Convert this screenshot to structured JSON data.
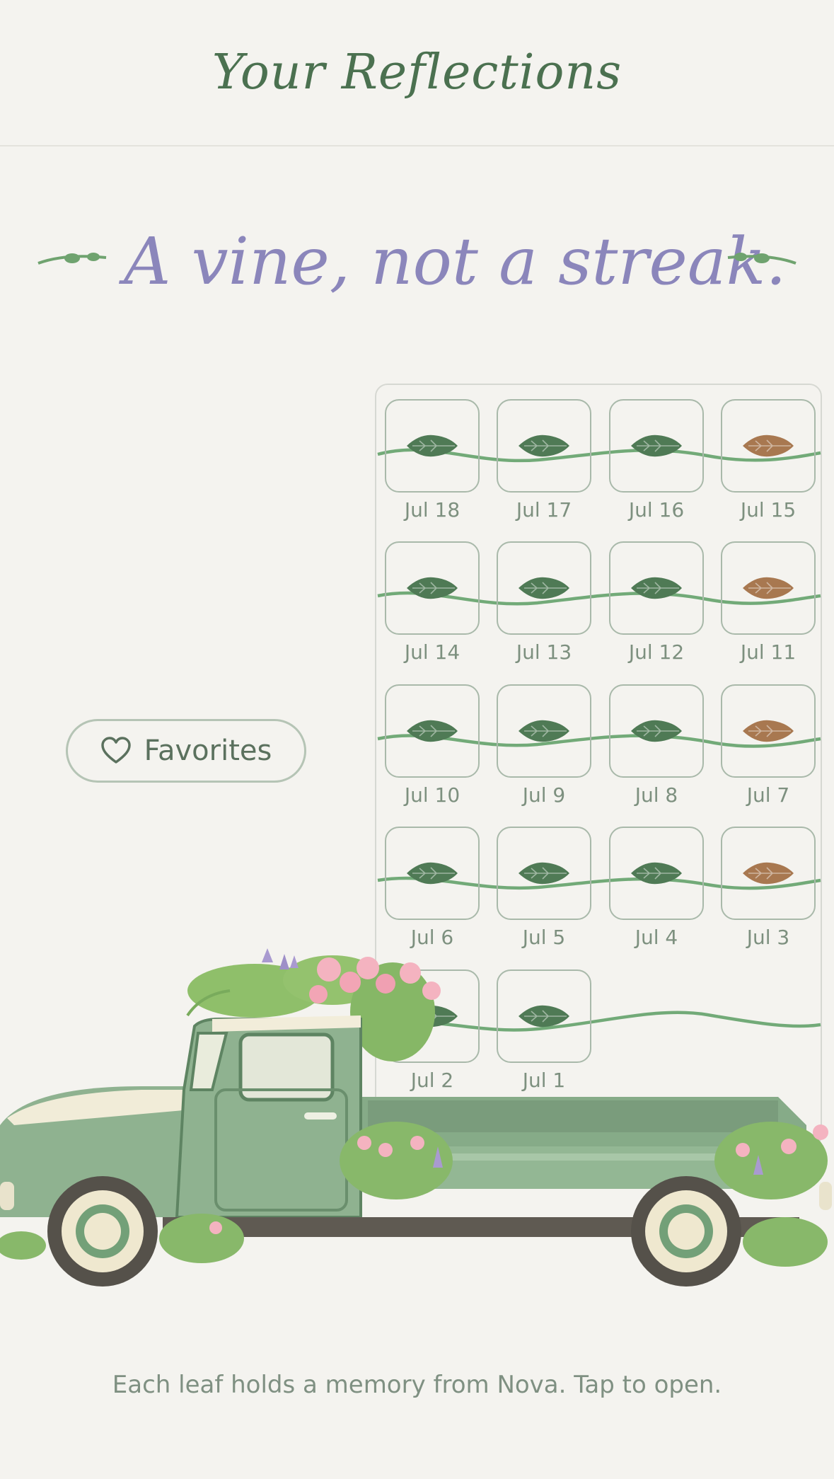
{
  "header": {
    "title": "Your Reflections"
  },
  "tagline": "A vine, not a streak.",
  "favorites": {
    "label": "Favorites",
    "icon": "heart-icon"
  },
  "calendar": {
    "rows": [
      [
        {
          "label": "Jul 18",
          "leaf": "green"
        },
        {
          "label": "Jul 17",
          "leaf": "green"
        },
        {
          "label": "Jul 16",
          "leaf": "green"
        },
        {
          "label": "Jul 15",
          "leaf": "brown"
        }
      ],
      [
        {
          "label": "Jul 14",
          "leaf": "green"
        },
        {
          "label": "Jul 13",
          "leaf": "green"
        },
        {
          "label": "Jul 12",
          "leaf": "green"
        },
        {
          "label": "Jul 11",
          "leaf": "brown"
        }
      ],
      [
        {
          "label": "Jul 10",
          "leaf": "green"
        },
        {
          "label": "Jul 9",
          "leaf": "green"
        },
        {
          "label": "Jul 8",
          "leaf": "green"
        },
        {
          "label": "Jul 7",
          "leaf": "brown"
        }
      ],
      [
        {
          "label": "Jul 6",
          "leaf": "green"
        },
        {
          "label": "Jul 5",
          "leaf": "green"
        },
        {
          "label": "Jul 4",
          "leaf": "green"
        },
        {
          "label": "Jul 3",
          "leaf": "brown"
        }
      ],
      [
        {
          "label": "Jul 2",
          "leaf": "green"
        },
        {
          "label": "Jul 1",
          "leaf": "green"
        }
      ]
    ]
  },
  "footer": {
    "text": "Each leaf holds a memory from Nova. Tap to open."
  },
  "colors": {
    "background": "#f4f3ef",
    "title_green": "#4b7150",
    "tagline_purple": "#8b86bb",
    "leaf_green": "#4f7a55",
    "leaf_brown": "#a87850",
    "vine_green": "#72aa78",
    "truck_green": "#8fb290"
  }
}
